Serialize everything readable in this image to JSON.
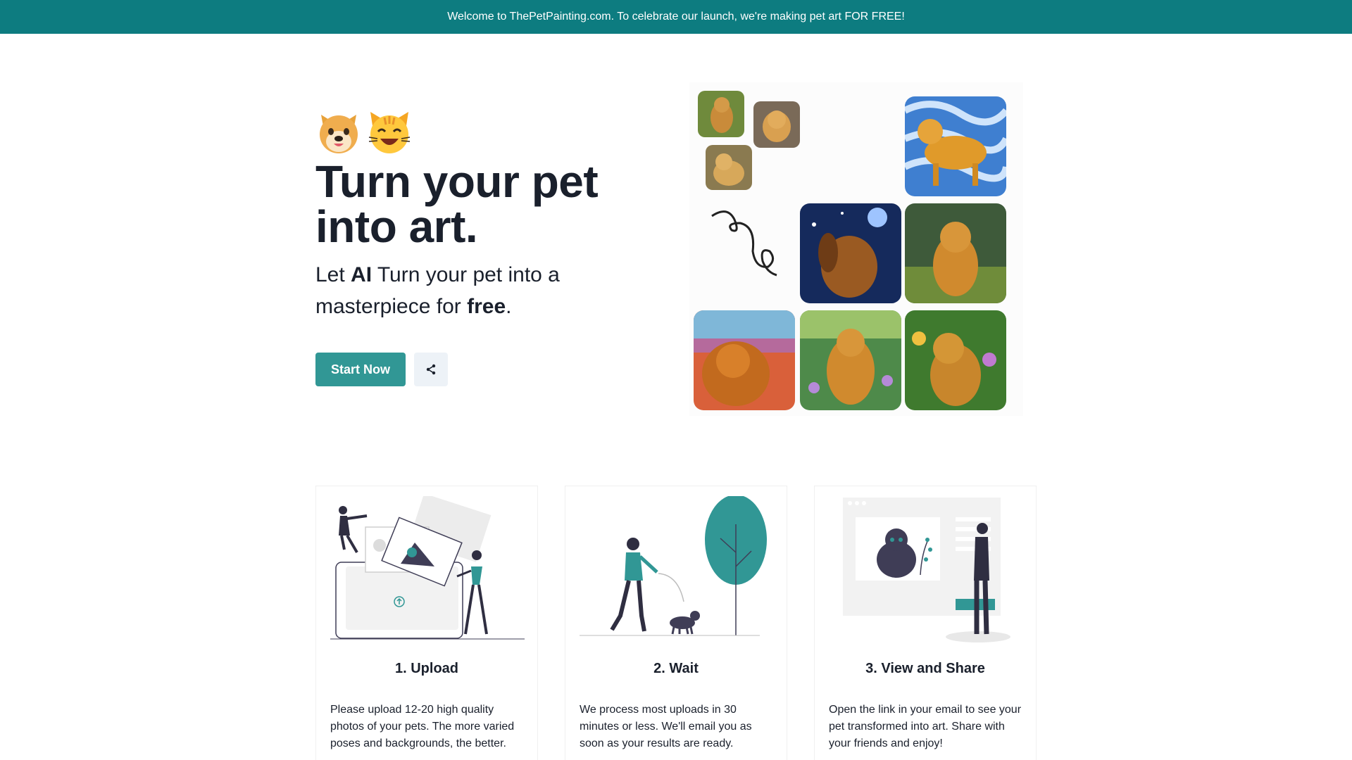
{
  "banner": {
    "text": "Welcome to ThePetPainting.com. To celebrate our launch, we're making pet art FOR FREE!"
  },
  "hero": {
    "emojis": [
      "dog-face-emoji",
      "cat-face-emoji"
    ],
    "headline": "Turn your pet into art.",
    "subline": {
      "p1": "Let ",
      "b1": "AI",
      "p2": " Turn your pet into a masterpiece for ",
      "b2": "free",
      "p3": "."
    },
    "start_button": "Start Now",
    "share_icon": "share-icon"
  },
  "steps": [
    {
      "title": "1. Upload",
      "text": "Please upload 12-20 high quality photos of your pets. The more varied poses and backgrounds, the better.",
      "illustration": "upload-illustration"
    },
    {
      "title": "2. Wait",
      "text": "We process most uploads in 30 minutes or less. We'll email you as soon as your results are ready.",
      "illustration": "dog-walk-illustration"
    },
    {
      "title": "3. View and Share",
      "text": "Open the link in your email to see your pet transformed into art. Share with your friends and enjoy!",
      "illustration": "view-art-illustration"
    }
  ],
  "colors": {
    "banner": "#0d7c80",
    "accent": "#319795",
    "text": "#1a202c"
  }
}
